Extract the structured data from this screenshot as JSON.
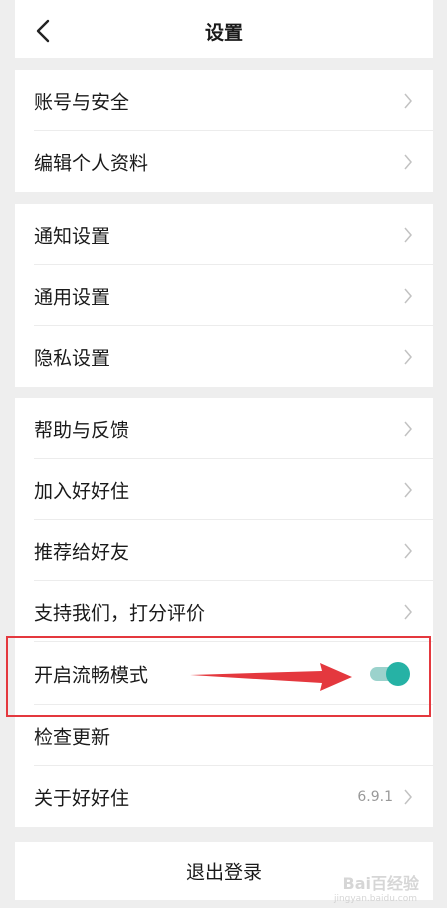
{
  "header": {
    "title": "设置",
    "back_icon": "chevron-left-icon"
  },
  "groups": [
    {
      "items": [
        {
          "label": "账号与安全",
          "trailing": "chevron-right-icon"
        },
        {
          "label": "编辑个人资料",
          "trailing": "chevron-right-icon"
        }
      ]
    },
    {
      "items": [
        {
          "label": "通知设置",
          "trailing": "chevron-right-icon"
        },
        {
          "label": "通用设置",
          "trailing": "chevron-right-icon"
        },
        {
          "label": "隐私设置",
          "trailing": "chevron-right-icon"
        }
      ]
    },
    {
      "items": [
        {
          "label": "帮助与反馈",
          "trailing": "chevron-right-icon"
        },
        {
          "label": "加入好好住",
          "trailing": "chevron-right-icon"
        },
        {
          "label": "推荐给好友",
          "trailing": "chevron-right-icon"
        },
        {
          "label": "支持我们，打分评价",
          "trailing": "chevron-right-icon"
        },
        {
          "label": "开启流畅模式",
          "trailing": "toggle",
          "toggle_on": true
        },
        {
          "label": "检查更新",
          "trailing": "none"
        },
        {
          "label": "关于好好住",
          "trailing": "chevron-right-icon",
          "value": "6.9.1"
        }
      ]
    }
  ],
  "logout": {
    "label": "退出登录"
  },
  "annotation": {
    "highlight_color": "#e4383e",
    "arrow_color": "#e4383e"
  },
  "colors": {
    "toggle_knob": "#26b2a5",
    "toggle_track": "#9bd2cc",
    "background": "#eeeeee"
  },
  "watermark": {
    "text": "Bai百经验",
    "sub": "jingyan.baidu.com"
  }
}
